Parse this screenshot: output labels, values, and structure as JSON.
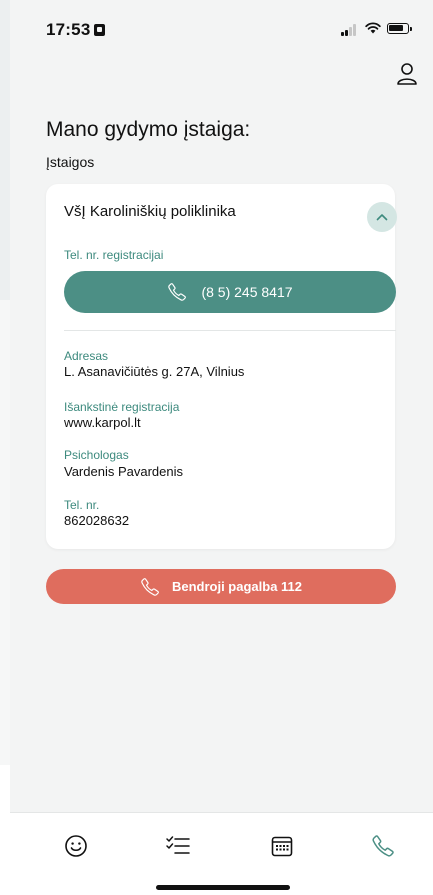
{
  "status_bar": {
    "time": "17:53"
  },
  "header": {
    "title": "Mano gydymo įstaiga:",
    "section_label": "Įstaigos"
  },
  "institution": {
    "name": "VšĮ Karoliniškių poliklinika",
    "registration_label": "Tel. nr. registracijai",
    "registration_phone": "(8 5) 245 8417",
    "fields": [
      {
        "label": "Adresas",
        "value": "L. Asanavičiūtės g. 27A, Vilnius"
      },
      {
        "label": "Išankstinė registracija",
        "value": "www.karpol.lt"
      },
      {
        "label": "Psichologas",
        "value": "Vardenis Pavardenis"
      },
      {
        "label": "Tel. nr.",
        "value": "862028632"
      }
    ]
  },
  "emergency": {
    "label": "Bendroji pagalba 112"
  },
  "tabbar": {
    "tabs": [
      {
        "icon": "smiley-icon",
        "active": false
      },
      {
        "icon": "checklist-icon",
        "active": false
      },
      {
        "icon": "calendar-icon",
        "active": false
      },
      {
        "icon": "phone-icon",
        "active": true
      }
    ]
  },
  "colors": {
    "accent": "#4c8f85",
    "accent_text": "#3d8a7e",
    "emergency": "#df6d5e",
    "background": "#f3f4f4"
  }
}
